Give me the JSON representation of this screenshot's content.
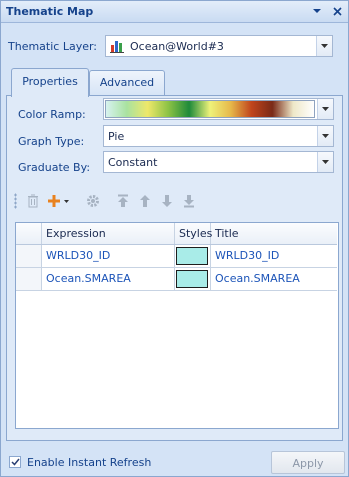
{
  "window": {
    "title": "Thematic Map"
  },
  "thematic_layer": {
    "label": "Thematic Layer:",
    "value": "Ocean@World#3",
    "icon": "layer-chart-icon"
  },
  "tabs": [
    {
      "label": "Properties",
      "active": true
    },
    {
      "label": "Advanced",
      "active": false
    }
  ],
  "properties": {
    "color_ramp_label": "Color Ramp:",
    "color_ramp_stops": [
      "#d7f2f0",
      "#a9e2a0",
      "#eee86a",
      "#8cc245",
      "#1e8a3a",
      "#eef27a",
      "#e6b84a",
      "#c0441c",
      "#7a2a18",
      "#eee8c8",
      "#ffffff"
    ],
    "graph_type_label": "Graph Type:",
    "graph_type_value": "Pie",
    "graduate_by_label": "Graduate By:",
    "graduate_by_value": "Constant"
  },
  "toolbar": {
    "buttons": [
      "delete-icon",
      "add-icon",
      "settings-icon",
      "move-top-icon",
      "move-up-icon",
      "move-down-icon",
      "move-bottom-icon"
    ]
  },
  "grid": {
    "columns": [
      "",
      "Expression",
      "Styles",
      "Title"
    ],
    "rows": [
      {
        "expression": "WRLD30_ID",
        "style_color": "#a9ece8",
        "title": "WRLD30_ID"
      },
      {
        "expression": "Ocean.SMAREA",
        "style_color": "#a9ece8",
        "title": "Ocean.SMAREA"
      }
    ]
  },
  "footer": {
    "instant_refresh_label": "Enable Instant Refresh",
    "instant_refresh_checked": true,
    "apply_label": "Apply"
  }
}
